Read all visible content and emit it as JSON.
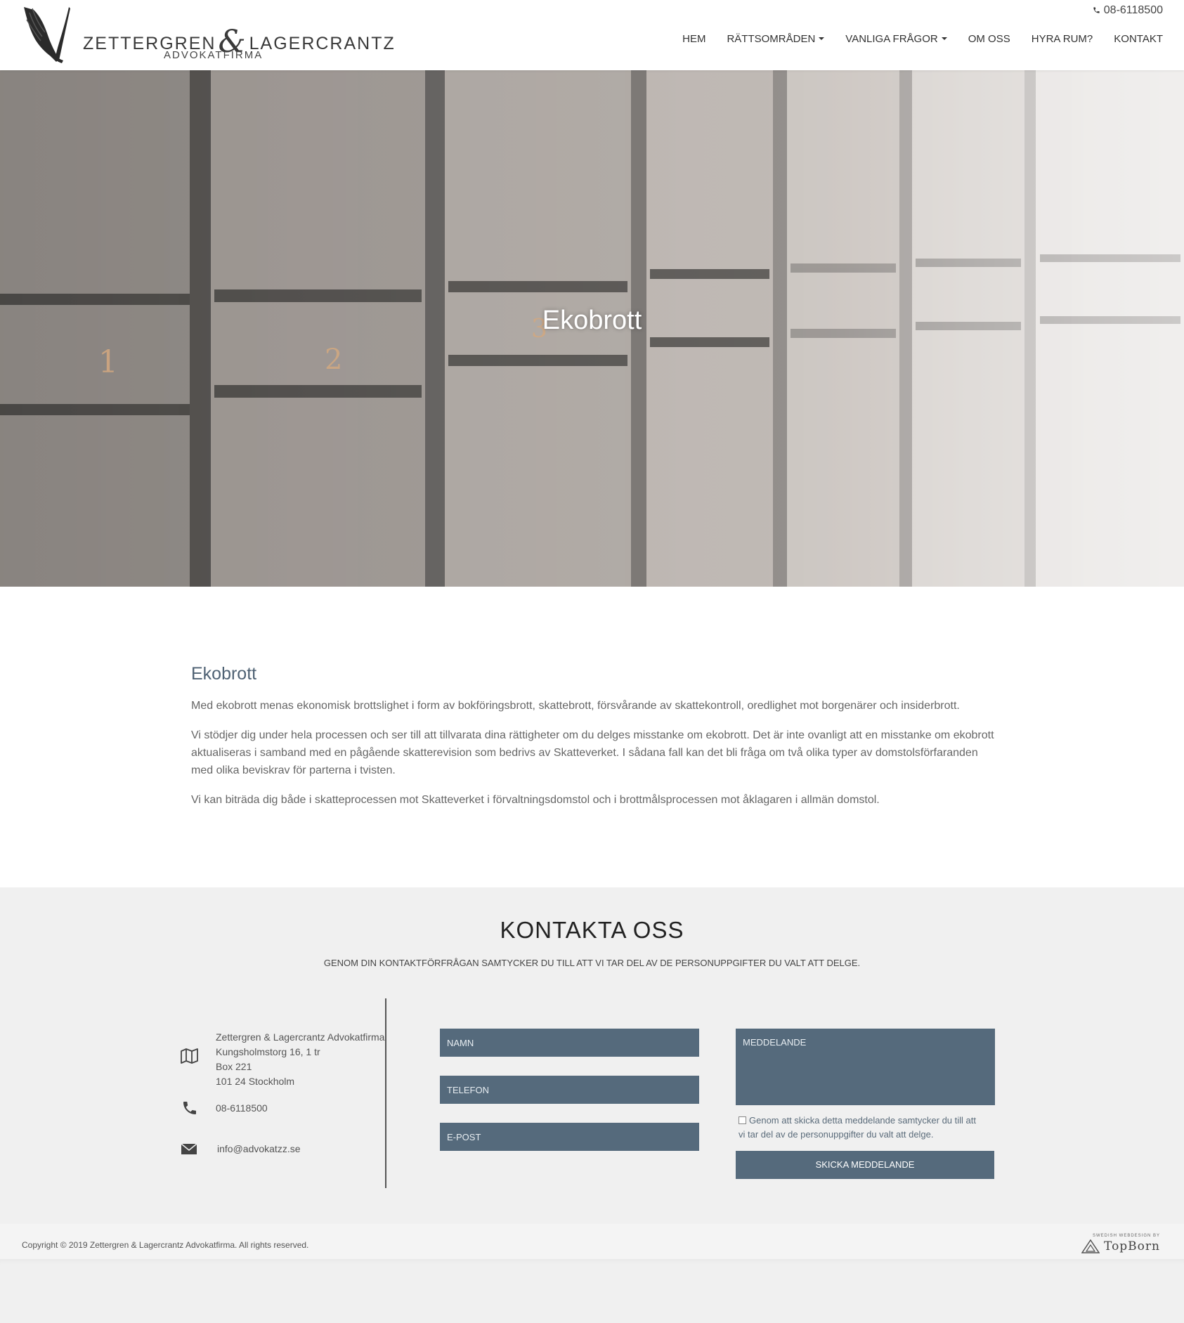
{
  "header": {
    "logo_line": [
      "ZETTERGREN",
      "&",
      "LAGERCRANTZ"
    ],
    "logo_sub": "ADVOKATFIRMA",
    "phone": "08-6118500",
    "nav": [
      {
        "label": "HEM"
      },
      {
        "label": "RÄTTSOMRÅDEN"
      },
      {
        "label": "VANLIGA FRÅGOR"
      },
      {
        "label": "OM OSS"
      },
      {
        "label": "HYRA RUM?"
      },
      {
        "label": "KONTAKT"
      }
    ]
  },
  "hero": {
    "title": "Ekobrott",
    "spine_numbers": [
      "1",
      "2",
      "3"
    ]
  },
  "content": {
    "heading": "Ekobrott",
    "paragraphs": [
      "Med ekobrott menas ekonomisk brottslighet i form av bokföringsbrott, skattebrott, försvårande av skattekontroll, oredlighet mot borgenärer och insiderbrott.",
      "Vi stödjer dig under hela processen och ser till att tillvarata dina rättigheter om du delges misstanke om ekobrott. Det är inte ovanligt att en misstanke om ekobrott aktualiseras i samband med en pågående skatterevision som bedrivs av Skatteverket. I sådana fall kan det bli fråga om två olika typer av domstolsförfaranden med olika beviskrav för parterna i tvisten.",
      "Vi kan biträda dig både i skatteprocessen mot Skatteverket i förvaltningsdomstol och i brottmålsprocessen mot åklagaren i allmän domstol."
    ]
  },
  "contact": {
    "title": "KONTAKTA OSS",
    "subtitle": "GENOM DIN KONTAKTFÖRFRÅGAN SAMTYCKER DU TILL ATT VI TAR DEL AV DE PERSONUPPGIFTER DU VALT ATT DELGE.",
    "address": [
      "Zettergren & Lagercrantz Advokatfirma",
      "Kungsholmstorg 16, 1 tr",
      "Box 221",
      "101 24 Stockholm"
    ],
    "phone": "08-6118500",
    "email": "info@advokatzz.se",
    "form": {
      "name_placeholder": "NAMN",
      "phone_placeholder": "TELEFON",
      "email_placeholder": "E-POST",
      "message_placeholder": "MEDDELANDE",
      "consent_text": "Genom att skicka detta meddelande samtycker du till att vi tar del av de personuppgifter du valt att delge.",
      "submit_label": "SKICKA MEDDELANDE"
    }
  },
  "footer": {
    "copyright": "Copyright © 2019 Zettergren & Lagercrantz Advokatfirma. All rights reserved.",
    "badge_small": "SWEDISH WEBDESIGN BY",
    "badge_big": "TopBorn"
  },
  "colors": {
    "accent": "#556a7c",
    "heading_blue": "#4f6274"
  },
  "icons": [
    "phone-icon",
    "map-icon",
    "phone-icon",
    "envelope-icon",
    "caret-down-icon",
    "bird-logo-icon",
    "topborn-logo-icon"
  ]
}
